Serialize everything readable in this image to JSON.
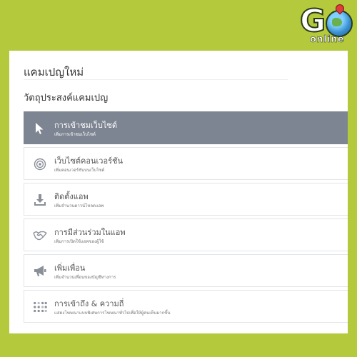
{
  "logo": {
    "letter": "G",
    "subtext": "online"
  },
  "page": {
    "title": "แคมเปญใหม่",
    "subtitle": "วัตถุประสงค์แคมเปญ"
  },
  "objectives": [
    {
      "label": "การเข้าชมเว็บไซต์",
      "desc": "เพิ่มการเข้าชมเว็บไซต์",
      "icon": "cursor-icon",
      "selected": true
    },
    {
      "label": "เว็บไซต์คอนเวอร์ชัน",
      "desc": "เพิ่มคอนเวอร์ชันบนเว็บไซต์",
      "icon": "target-icon",
      "selected": false
    },
    {
      "label": "ติดตั้งแอพ",
      "desc": "เพิ่มจำนวนดาวน์โหลดแอพ",
      "icon": "download-icon",
      "selected": false
    },
    {
      "label": "การมีส่วนร่วมในแอพ",
      "desc": "เพิ่มการเปิดใช้แอพของผู้ใช้",
      "icon": "handshake-icon",
      "selected": false
    },
    {
      "label": "เพิ่มเพื่อน",
      "desc": "เพิ่มจำนวนเพื่อนของบัญชีทางการ",
      "icon": "megaphone-icon",
      "selected": false
    },
    {
      "label": "การเข้าถึง & ความถี่",
      "desc": "แสดงโฆษณาแบบพิเศษการโฆษณาทั่วไปเพื่อให้ผู้คนเห็นมากขึ้น",
      "icon": "reach-dots-icon",
      "selected": false
    }
  ],
  "colors": {
    "background": "#b5c93c",
    "selected": "#7e8592",
    "icon": "#8a8f99"
  }
}
